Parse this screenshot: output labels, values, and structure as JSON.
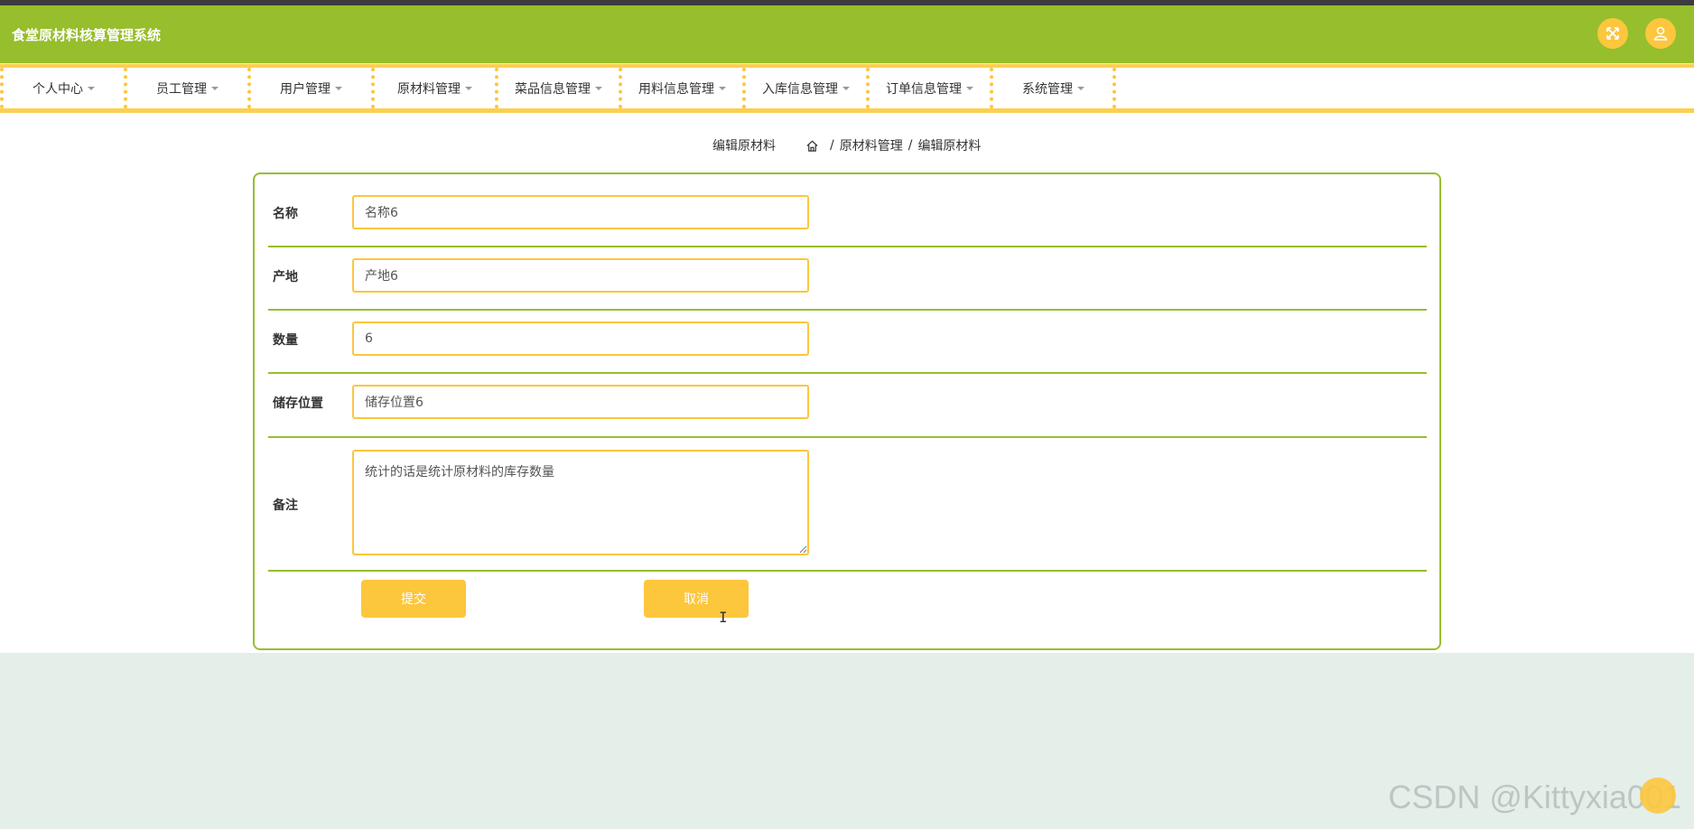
{
  "app": {
    "title": "食堂原材料核算管理系统"
  },
  "header": {
    "fullscreen_icon": "fullscreen-icon",
    "user_icon": "user-icon"
  },
  "nav": {
    "items": [
      {
        "label": "个人中心"
      },
      {
        "label": "员工管理"
      },
      {
        "label": "用户管理"
      },
      {
        "label": "原材料管理"
      },
      {
        "label": "菜品信息管理"
      },
      {
        "label": "用料信息管理"
      },
      {
        "label": "入库信息管理"
      },
      {
        "label": "订单信息管理"
      },
      {
        "label": "系统管理"
      }
    ]
  },
  "page": {
    "title": "编辑原材料",
    "breadcrumb": [
      "原材料管理",
      "编辑原材料"
    ],
    "breadcrumb_sep": "/"
  },
  "form": {
    "fields": [
      {
        "label": "名称",
        "value": "名称6"
      },
      {
        "label": "产地",
        "value": "产地6"
      },
      {
        "label": "数量",
        "value": "6"
      },
      {
        "label": "储存位置",
        "value": "储存位置6"
      }
    ],
    "remark": {
      "label": "备注",
      "value": "统计的话是统计原材料的库存数量"
    },
    "submit_label": "提交",
    "cancel_label": "取消"
  },
  "watermark": "CSDN @Kittyxia001",
  "colors": {
    "primary": "#97be2d",
    "accent": "#fcc63d",
    "background": "#e4efea"
  }
}
